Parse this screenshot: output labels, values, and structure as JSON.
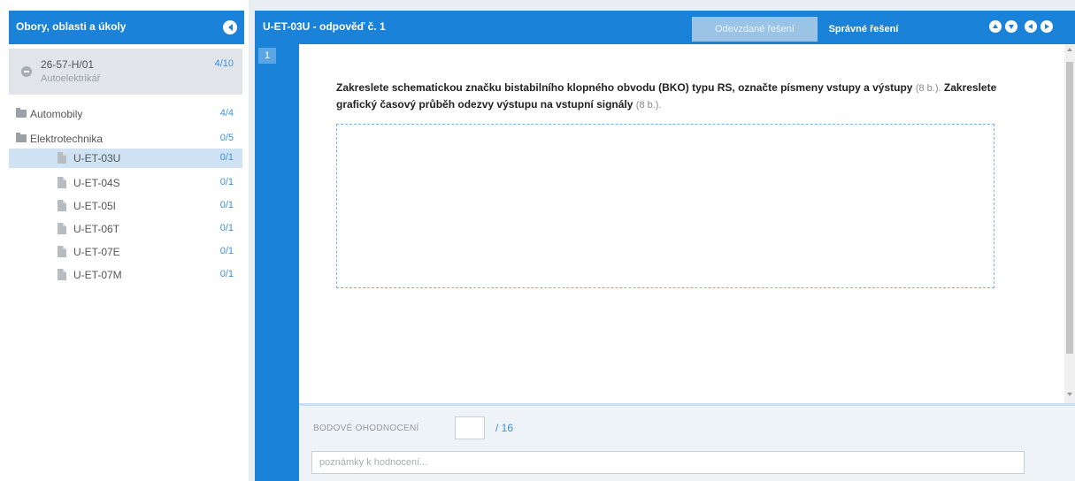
{
  "sidebar": {
    "title": "Obory, oblasti a úkoly",
    "field": {
      "code": "26-57-H/01",
      "name": "Autoelektrikář",
      "score": "4/10"
    },
    "items": [
      {
        "label": "Automobily",
        "score": "4/4",
        "type": "folder"
      },
      {
        "label": "Elektrotechnika",
        "score": "0/5",
        "type": "folder"
      },
      {
        "label": "U-ET-03U",
        "score": "0/1",
        "type": "task",
        "selected": true
      },
      {
        "label": "U-ET-04S",
        "score": "0/1",
        "type": "task"
      },
      {
        "label": "U-ET-05I",
        "score": "0/1",
        "type": "task"
      },
      {
        "label": "U-ET-06T",
        "score": "0/1",
        "type": "task"
      },
      {
        "label": "U-ET-07E",
        "score": "0/1",
        "type": "task"
      },
      {
        "label": "U-ET-07M",
        "score": "0/1",
        "type": "task"
      }
    ]
  },
  "header": {
    "title": "U-ET-03U - odpověď č. 1",
    "tabs": [
      {
        "label": "Odevzdané řešení",
        "active": false
      },
      {
        "label": "Správné řešení",
        "active": true
      }
    ],
    "nav_icons": [
      "arrow-up-icon",
      "arrow-down-icon",
      "arrow-left-icon",
      "arrow-right-icon"
    ]
  },
  "answer": {
    "number": "1",
    "q_part1": "Zakreslete schematickou značku bistabilního klopného obvodu (BKO) typu RS, označte písmeny vstupy a výstupy",
    "q_pts1": "(8 b.).",
    "q_part2": "Zakreslete grafický časový průběh odezvy výstupu na vstupní signály",
    "q_pts2": "(8 b.)."
  },
  "evaluation": {
    "score_label": "BODOVÉ OHODNOCENÍ",
    "score_value": "",
    "score_max": "/ 16",
    "notes_placeholder": "poznámky k hodnocení..."
  },
  "colors": {
    "accent": "#1a82d8",
    "selected_row": "#cfe3f4",
    "score_text": "#3d8fd8"
  }
}
